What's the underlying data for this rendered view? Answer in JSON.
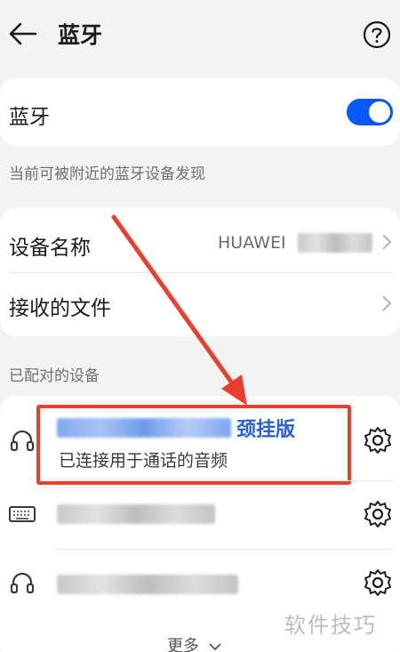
{
  "header": {
    "title": "蓝牙",
    "back_icon": "arrow-left-icon",
    "help_icon": "question-circle-icon"
  },
  "bluetooth": {
    "label": "蓝牙",
    "enabled": true,
    "toggle_color": "#0a59f7",
    "discoverable_text": "当前可被附近的蓝牙设备发现"
  },
  "device_info": {
    "name_label": "设备名称",
    "name_value": "HUAWEI",
    "received_files_label": "接收的文件"
  },
  "paired": {
    "section_title": "已配对的设备",
    "devices": [
      {
        "icon": "headphones-icon",
        "name_suffix": "颈挂版",
        "status": "已连接用于通话的音频"
      },
      {
        "icon": "keyboard-icon"
      },
      {
        "icon": "headphones-icon"
      }
    ],
    "more_label": "更多"
  },
  "annotation": {
    "highlight_color": "#e8402e"
  },
  "watermark": "软件技巧"
}
